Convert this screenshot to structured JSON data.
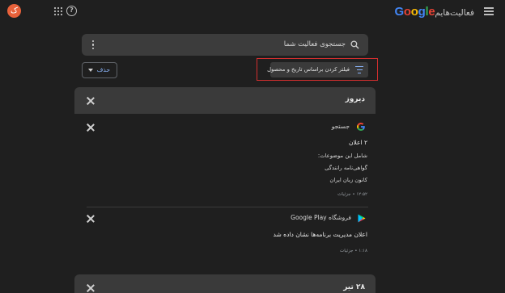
{
  "header": {
    "brand": "Google",
    "title": "فعالیت‌هایم",
    "avatar_letter": "ک"
  },
  "search": {
    "placeholder": "جستجوی فعالیت شما"
  },
  "filters": {
    "delete_label": "حذف",
    "filter_label": "فیلتر کردن براساس تاریخ و محصول"
  },
  "days": [
    {
      "label": "دیروز",
      "items": [
        {
          "product": "جستجو",
          "title": "۲ اعلان",
          "lines": [
            "شامل این موضوعات:",
            "گواهی‌نامه رانندگی",
            "کانون زبان ایران"
          ],
          "meta": "۱۲:۵۲ • جزئیات"
        },
        {
          "product": "فروشگاه Google Play",
          "title": "اعلان مدیریت برنامه‌ها نشان داده شد",
          "lines": [],
          "meta": "۱:۱۸ • جزئیات"
        }
      ]
    },
    {
      "label": "۲۸ تیر",
      "items": []
    }
  ],
  "colors": {
    "background": "#1f1f1f",
    "card": "#3a3a3a",
    "accent": "#8ab4f8",
    "highlight": "#d32f2f",
    "avatar": "#e8613a"
  }
}
